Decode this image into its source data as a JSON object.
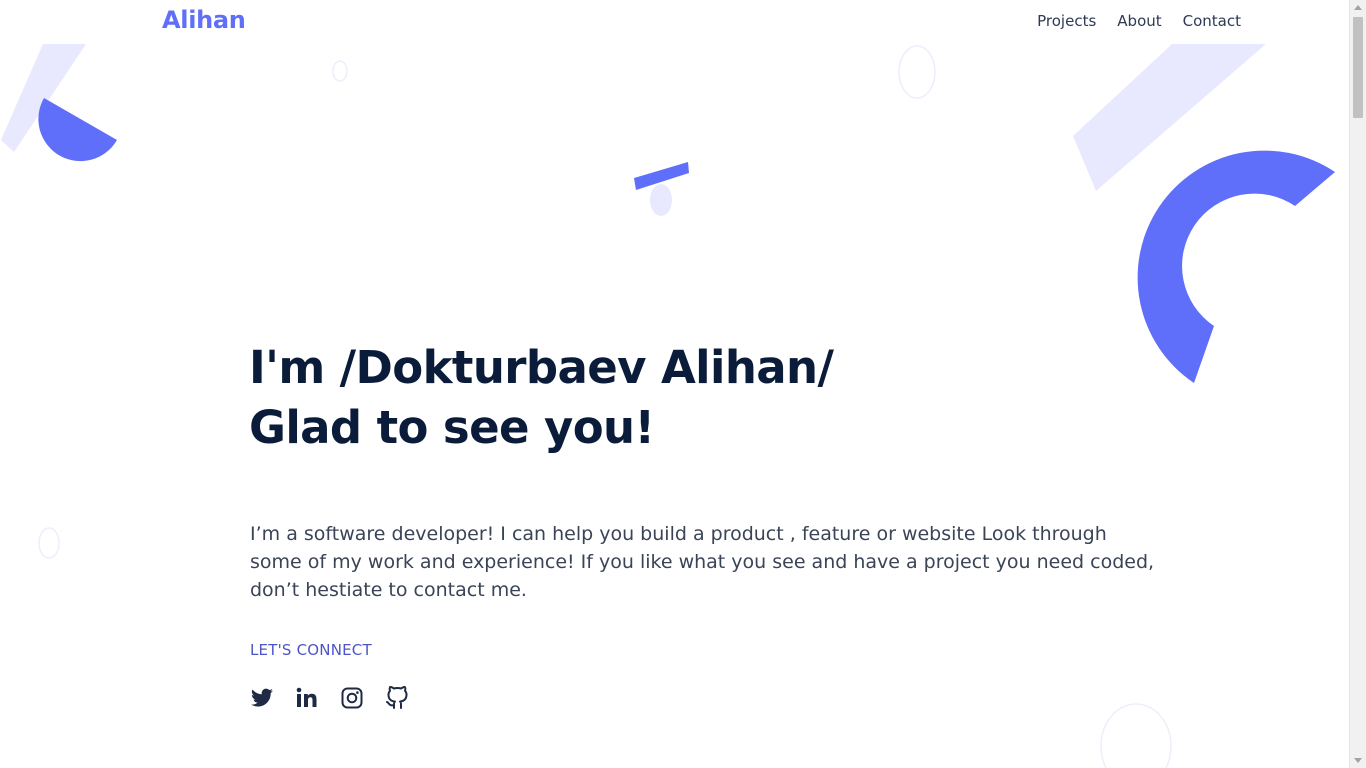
{
  "header": {
    "logo": "Alihan",
    "nav": [
      "Projects",
      "About",
      "Contact"
    ]
  },
  "hero": {
    "title_line1": "I'm /Dokturbaev Alihan/",
    "title_line2": "Glad to see you!",
    "description": "I’m a software developer! I can help you build a product , feature or website Look through some of my work and experience! If you like what you see and have a project you need coded, don’t hestiate to contact me.",
    "connect_label": "LET'S CONNECT",
    "socials": [
      "twitter-icon",
      "linkedin-icon",
      "instagram-icon",
      "github-icon"
    ]
  },
  "colors": {
    "accent": "#5f6ffa",
    "accent_light": "#e8e9fe",
    "heading": "#0b1c3a",
    "body_text": "#3a4456",
    "connect_text": "#4d55c6"
  }
}
